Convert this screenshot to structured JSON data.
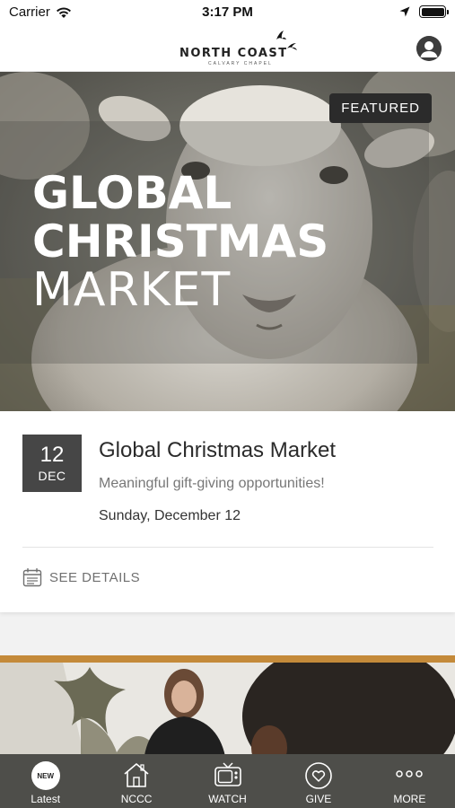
{
  "status_bar": {
    "carrier": "Carrier",
    "time": "3:17 PM"
  },
  "header": {
    "logo_title": "NORTH COAST",
    "logo_subtitle": "CALVARY CHAPEL"
  },
  "hero": {
    "badge": "FEATURED",
    "title_line1": "GLOBAL",
    "title_line2": "CHRISTMAS",
    "title_line3": "MARKET"
  },
  "event": {
    "day": "12",
    "month": "DEC",
    "title": "Global Christmas Market",
    "subtitle": "Meaningful gift-giving opportunities!",
    "date_text": "Sunday, December 12",
    "details_label": "SEE DETAILS"
  },
  "tabs": [
    {
      "label": "Latest",
      "badge": "NEW",
      "icon": "new-badge-icon"
    },
    {
      "label": "NCCC",
      "icon": "house-icon"
    },
    {
      "label": "WATCH",
      "icon": "tv-icon"
    },
    {
      "label": "GIVE",
      "icon": "heart-icon"
    },
    {
      "label": "MORE",
      "icon": "more-dots-icon"
    }
  ],
  "colors": {
    "accent": "#c48a3a",
    "tab_bar": "#4e4e4a",
    "date_box": "#464646"
  }
}
